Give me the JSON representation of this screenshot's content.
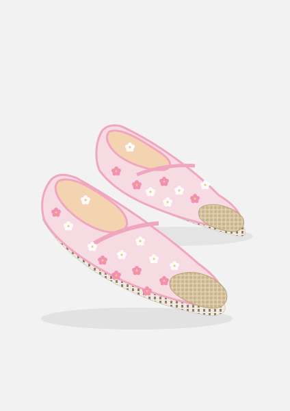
{
  "image": {
    "subject": "pair-of-espadrille-shoes",
    "colors": {
      "background": "#f2f2f2",
      "mesh": "#f7dbe3",
      "mesh_shadow": "#eab8c8",
      "trim": "#f1a6bf",
      "flower_pink": "#f38fb1",
      "flower_white": "#fffafc",
      "flower_yellow": "#e9d17a",
      "jute": "#d8c6a4",
      "jute_dark": "#b9a37c",
      "sole_stitch": "#8f7f6d",
      "insole": "#f3d3b0"
    }
  }
}
